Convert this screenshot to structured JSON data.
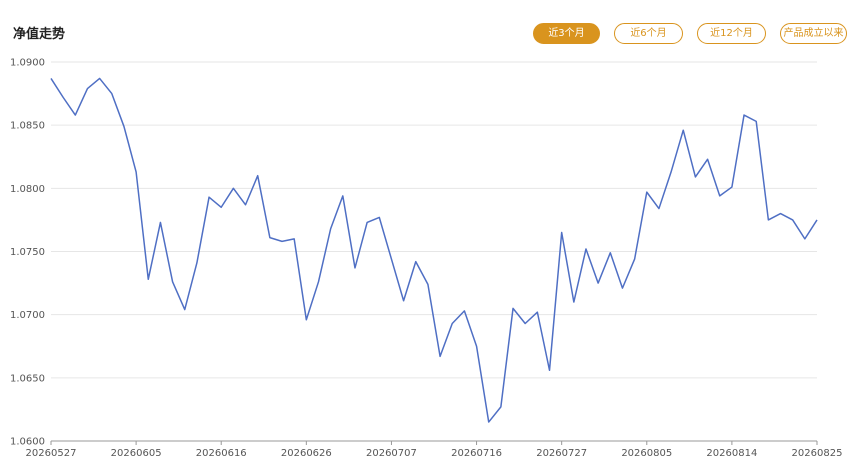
{
  "header": {
    "title": "净值走势"
  },
  "range_buttons": [
    {
      "label": "近3个月",
      "active": true
    },
    {
      "label": "近6个月",
      "active": false
    },
    {
      "label": "近12个月",
      "active": false
    },
    {
      "label": "产品成立以来",
      "active": false
    }
  ],
  "colors": {
    "accent": "#d9941e",
    "line": "#4f6fc4",
    "grid": "#e6e6e6",
    "axis": "#999999"
  },
  "chart_data": {
    "type": "line",
    "title": "",
    "xlabel": "",
    "ylabel": "",
    "ylim": [
      1.06,
      1.09
    ],
    "yticks": [
      "1.0600",
      "1.0650",
      "1.0700",
      "1.0750",
      "1.0800",
      "1.0850",
      "1.0900"
    ],
    "xticks": [
      "20260527",
      "20260605",
      "20260616",
      "20260626",
      "20260707",
      "20260716",
      "20260727",
      "20260805",
      "20260814",
      "20260825"
    ],
    "grid": true,
    "legend": "none",
    "series": [
      {
        "values": [
          1.0887,
          1.0872,
          1.0858,
          1.0879,
          1.0887,
          1.0875,
          1.0849,
          1.0813,
          1.0728,
          1.0773,
          1.0726,
          1.0704,
          1.0741,
          1.0793,
          1.0785,
          1.08,
          1.0787,
          1.081,
          1.0761,
          1.0758,
          1.076,
          1.0696,
          1.0726,
          1.0768,
          1.0794,
          1.0737,
          1.0773,
          1.0777,
          1.0744,
          1.0711,
          1.0742,
          1.0724,
          1.0667,
          1.0693,
          1.0703,
          1.0675,
          1.0615,
          1.0627,
          1.0705,
          1.0693,
          1.0702,
          1.0656,
          1.0765,
          1.071,
          1.0752,
          1.0725,
          1.0749,
          1.0721,
          1.0744,
          1.0797,
          1.0784,
          1.0813,
          1.0846,
          1.0809,
          1.0823,
          1.0794,
          1.0801,
          1.0858,
          1.0853,
          1.0775,
          1.078,
          1.0775,
          1.076,
          1.0775
        ]
      }
    ]
  }
}
